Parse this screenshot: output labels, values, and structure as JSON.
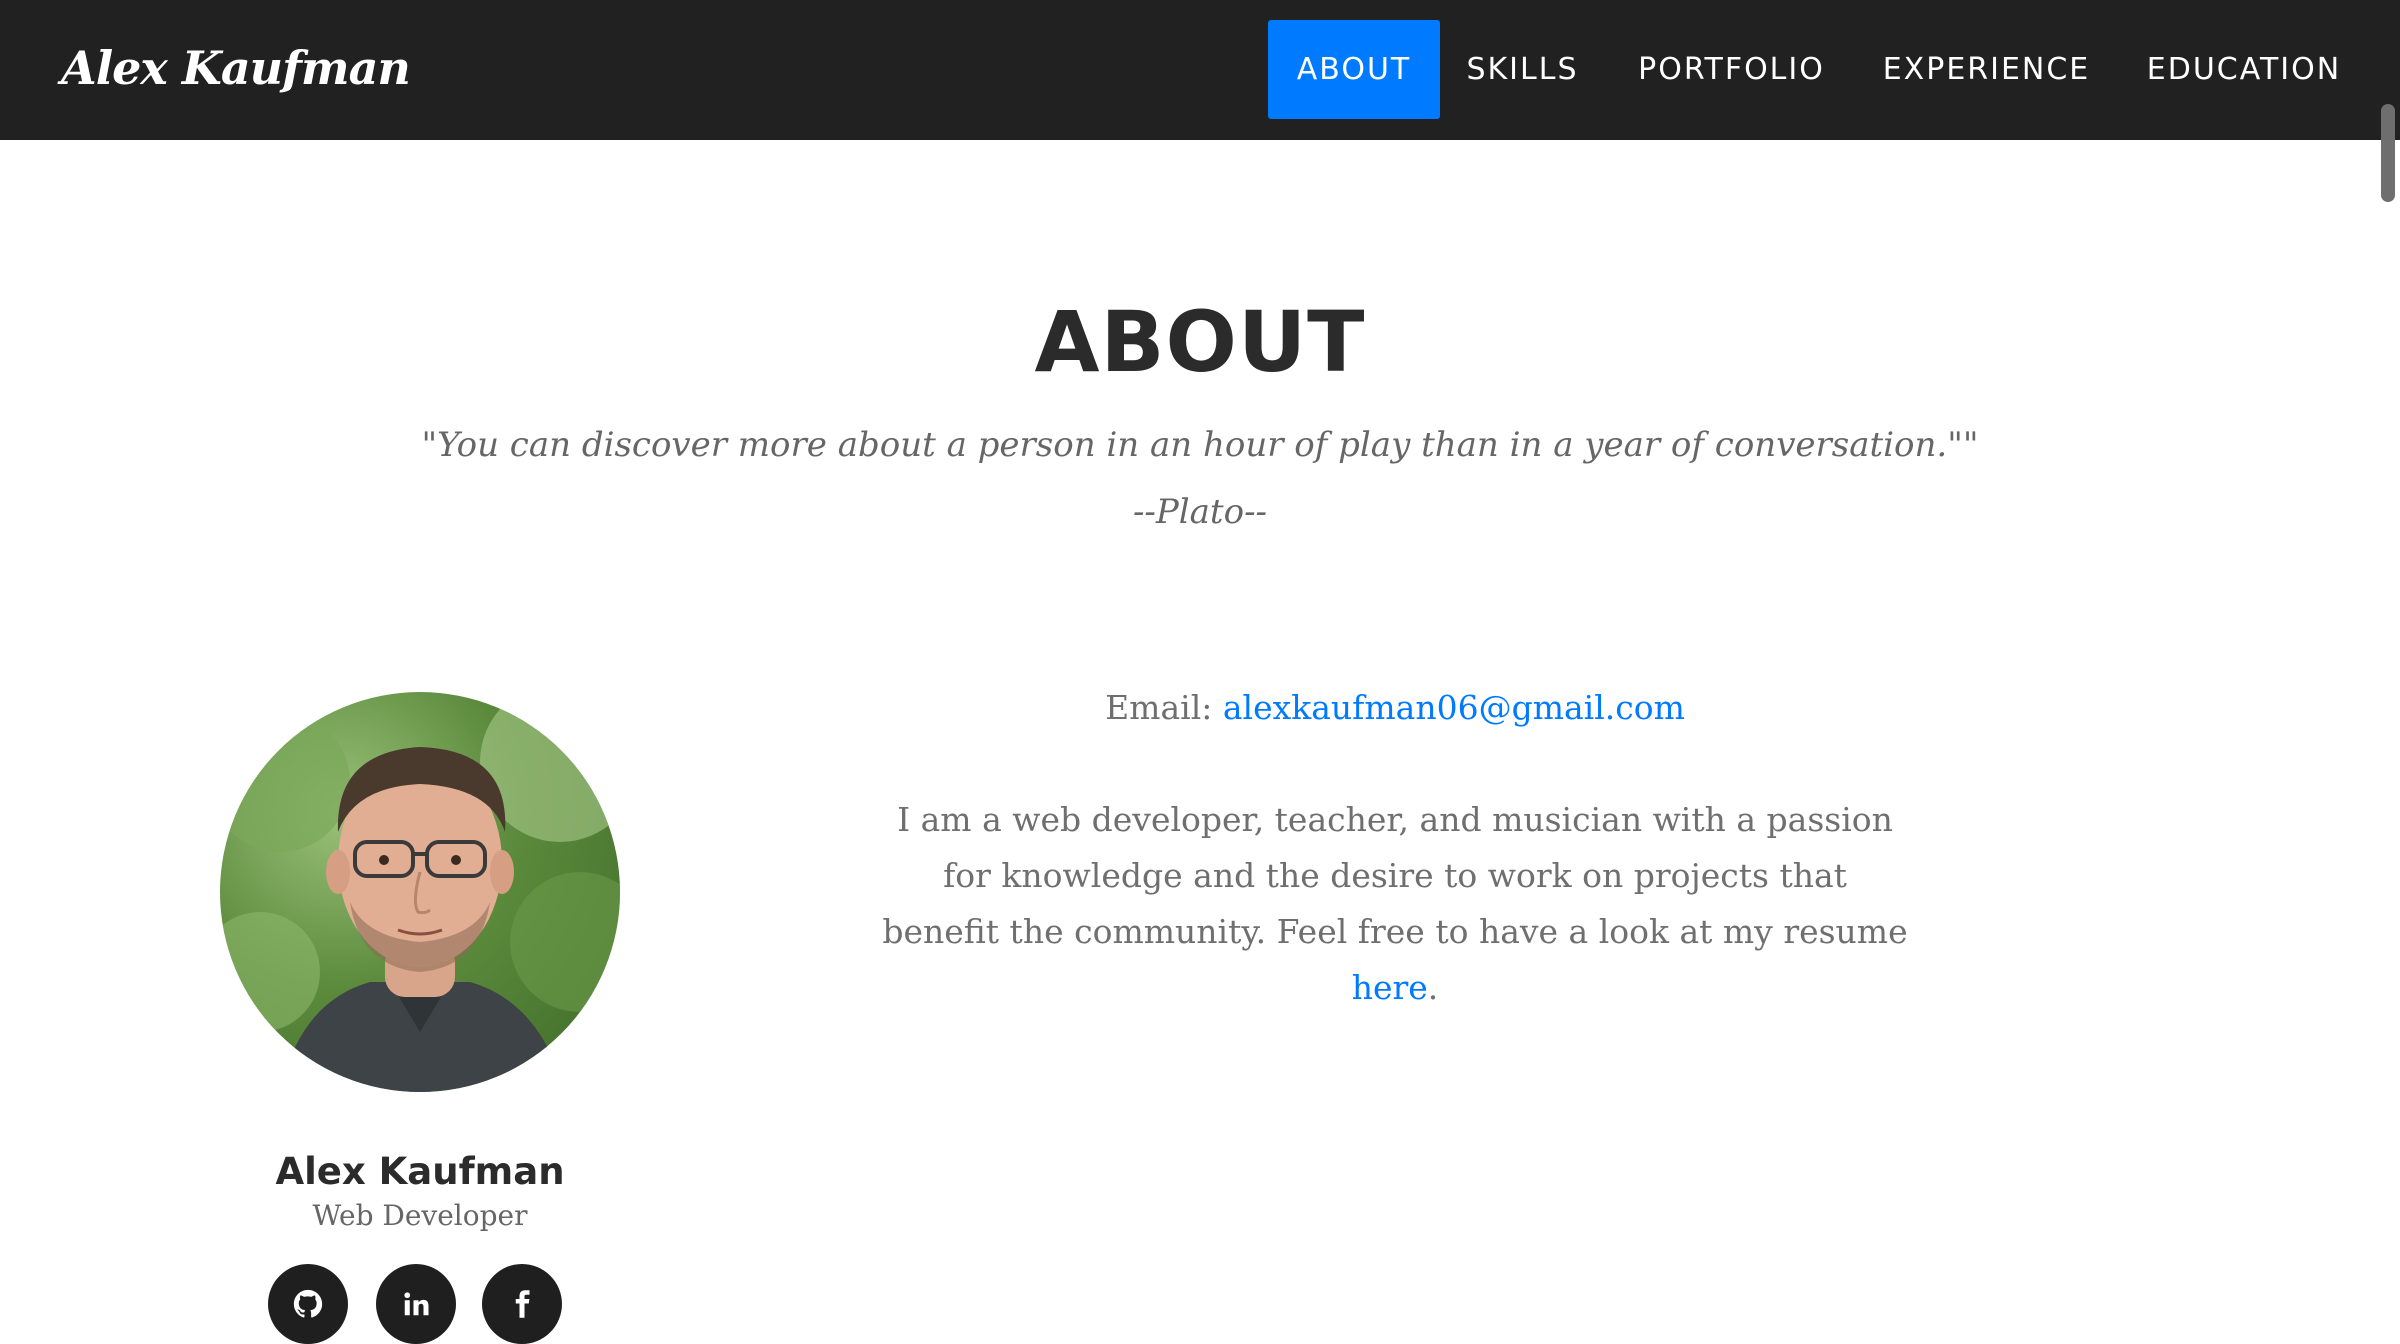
{
  "nav": {
    "brand": "Alex Kaufman",
    "items": [
      {
        "label": "ABOUT",
        "active": true
      },
      {
        "label": "SKILLS",
        "active": false
      },
      {
        "label": "PORTFOLIO",
        "active": false
      },
      {
        "label": "EXPERIENCE",
        "active": false
      },
      {
        "label": "EDUCATION",
        "active": false
      }
    ]
  },
  "about": {
    "title": "ABOUT",
    "quote": "\"You can discover more about a person in an hour of play than in a year of conversation.\"\"",
    "quote_author": "--Plato--",
    "email_label": "Email: ",
    "email": "alexkaufman06@gmail.com",
    "bio_text": "I am a web developer, teacher, and musician with a passion for knowledge and the desire to work on projects that benefit the community. Feel free to have a look at my resume ",
    "bio_link": "here",
    "bio_end": "."
  },
  "profile": {
    "name": "Alex Kaufman",
    "role": "Web Developer",
    "social": [
      "github-icon",
      "linkedin-icon",
      "facebook-icon"
    ]
  },
  "colors": {
    "nav_bg": "#212121",
    "accent": "#007bff",
    "heading": "#2b2b2b",
    "body_text": "#6f6f6f"
  }
}
